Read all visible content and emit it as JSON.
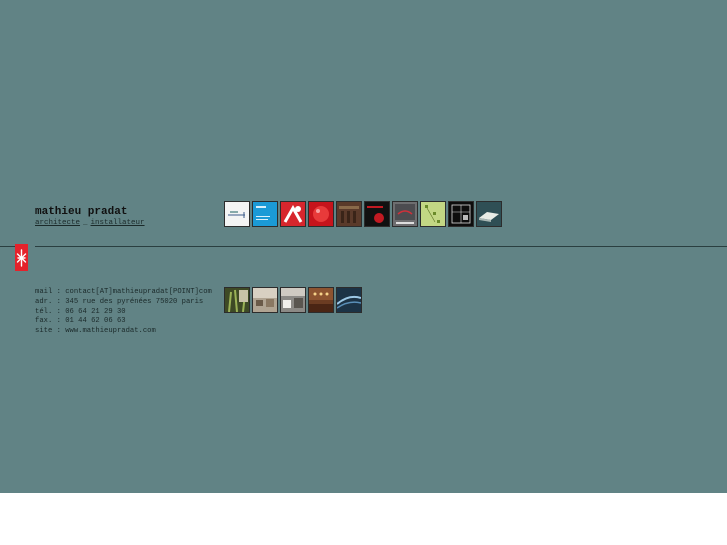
{
  "header": {
    "name": "mathieu pradat",
    "roles": [
      "architecte",
      "installateur"
    ],
    "roles_separator": "_"
  },
  "contact": {
    "lines": [
      "mail : contact[AT]mathieupradat[POINT]com",
      "adr. : 345 rue des pyrénées 75020 paris",
      "tél. : 06 64 21 29 30",
      "fax. : 01 44 62 06 63",
      "site : www.mathieupradat.com"
    ]
  },
  "projects_top": [
    {
      "name": "project-thumbnail-1",
      "icon": "white-diagram-thumbnail"
    },
    {
      "name": "project-thumbnail-2",
      "icon": "blue-poster-thumbnail"
    },
    {
      "name": "project-thumbnail-3",
      "icon": "red-graphic-thumbnail"
    },
    {
      "name": "project-thumbnail-4",
      "icon": "red-object-thumbnail"
    },
    {
      "name": "project-thumbnail-5",
      "icon": "brown-interior-thumbnail"
    },
    {
      "name": "project-thumbnail-6",
      "icon": "black-red-thumbnail"
    },
    {
      "name": "project-thumbnail-7",
      "icon": "grey-red-thumbnail"
    },
    {
      "name": "project-thumbnail-8",
      "icon": "green-plan-thumbnail"
    },
    {
      "name": "project-thumbnail-9",
      "icon": "black-plan-thumbnail"
    },
    {
      "name": "project-thumbnail-10",
      "icon": "teal-render-thumbnail"
    }
  ],
  "projects_bottom": [
    {
      "name": "photo-thumbnail-1",
      "icon": "plants-photo-thumbnail"
    },
    {
      "name": "photo-thumbnail-2",
      "icon": "room-photo-thumbnail"
    },
    {
      "name": "photo-thumbnail-3",
      "icon": "office-photo-thumbnail"
    },
    {
      "name": "photo-thumbnail-4",
      "icon": "brown-hall-photo-thumbnail"
    },
    {
      "name": "photo-thumbnail-5",
      "icon": "blue-curve-photo-thumbnail"
    }
  ],
  "colors": {
    "background": "#618385",
    "accent": "#e5222b",
    "text": "#1b2a2a"
  }
}
